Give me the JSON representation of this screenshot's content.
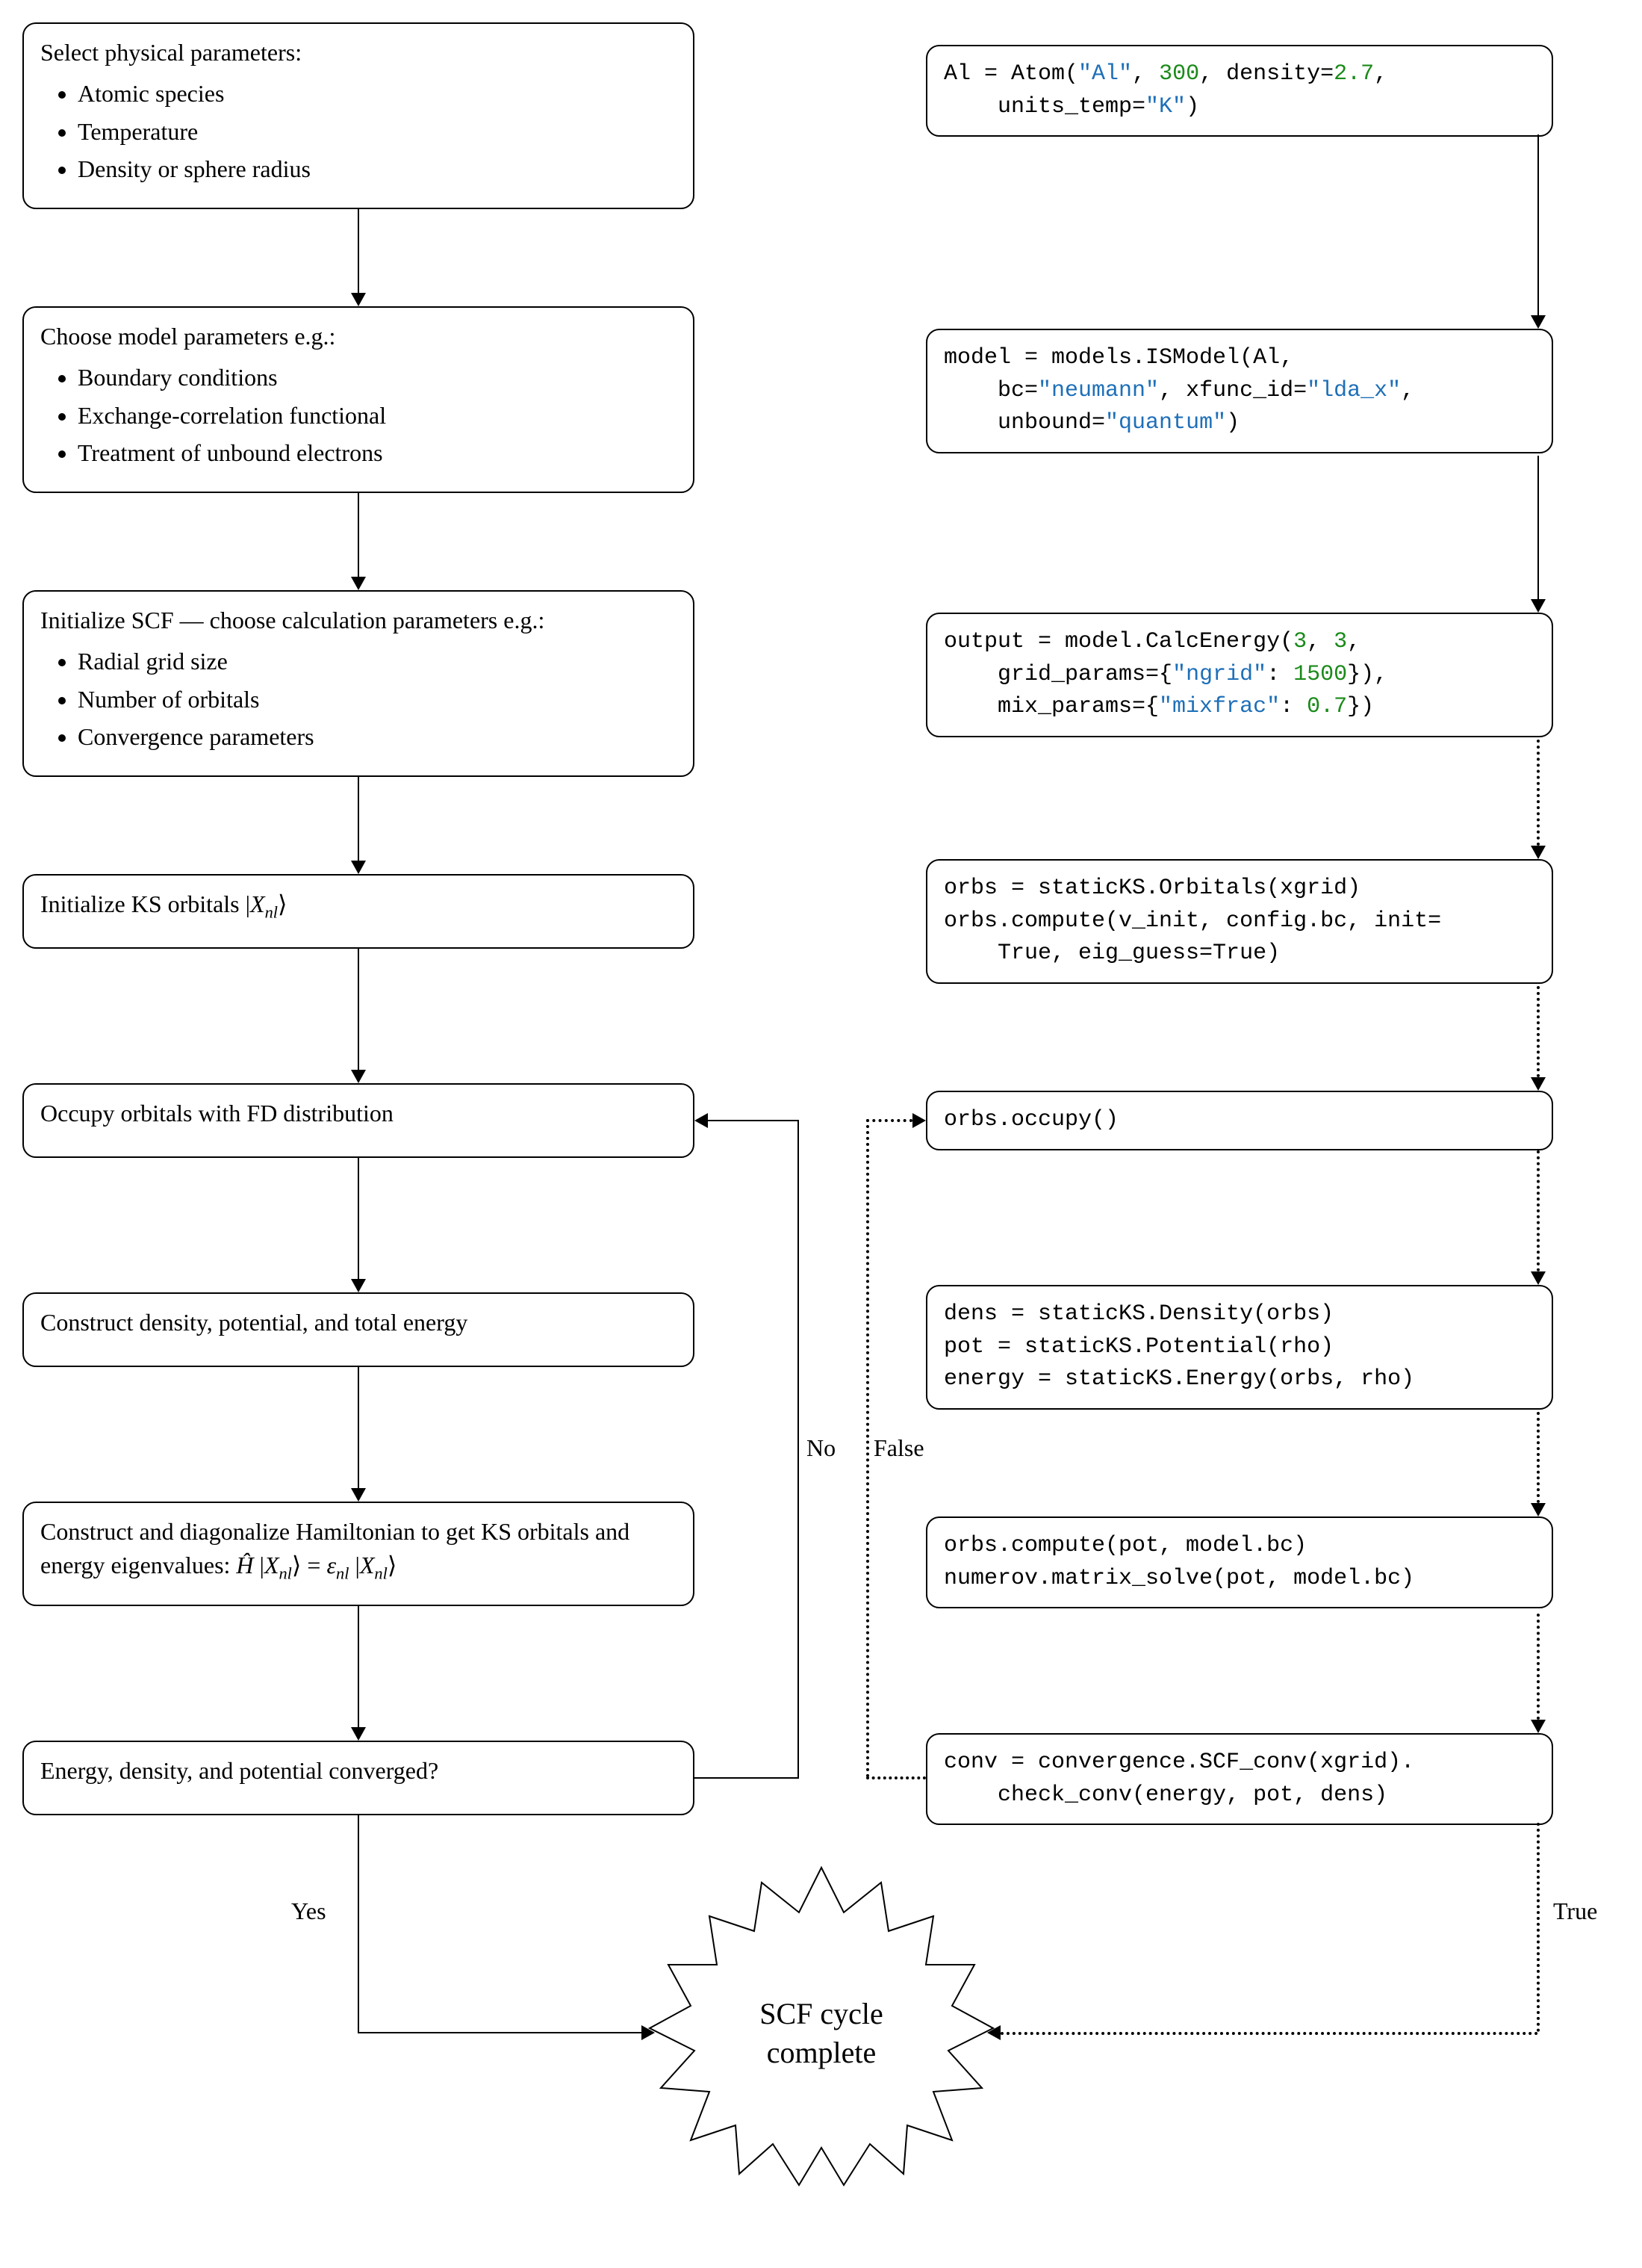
{
  "left": {
    "n1": {
      "title": "Select physical parameters:",
      "items": [
        "Atomic species",
        "Temperature",
        "Density or sphere radius"
      ]
    },
    "n2": {
      "title": "Choose model parameters e.g.:",
      "items": [
        "Boundary conditions",
        "Exchange-correlation functional",
        "Treatment of unbound electrons"
      ]
    },
    "n3": {
      "title": "Initialize SCF — choose calculation parameters e.g.:",
      "items": [
        "Radial grid size",
        "Number of orbitals",
        "Convergence parameters"
      ]
    },
    "n4": "Initialize KS orbitals |X_nl⟩",
    "n5": "Occupy orbitals with FD distribution",
    "n6": "Construct density, potential, and total energy",
    "n7": "Construct and diagonalize Hamiltonian to get KS orbitals and energy eigenvalues: Ĥ |X_nl⟩ = ε_nl |X_nl⟩",
    "n8": "Energy, density, and potential converged?"
  },
  "right": {
    "r1": {
      "l1a": "Al = Atom(",
      "l1b": "\"Al\"",
      "l1c": ", ",
      "l1d": "300",
      "l1e": ", density=",
      "l1f": "2.7",
      "l1g": ",",
      "l2a": "    units_temp=",
      "l2b": "\"K\"",
      "l2c": ")"
    },
    "r2": {
      "l1": "model = models.ISModel(Al,",
      "l2a": "    bc=",
      "l2b": "\"neumann\"",
      "l2c": ", xfunc_id=",
      "l2d": "\"lda_x\"",
      "l2e": ",",
      "l3a": "    unbound=",
      "l3b": "\"quantum\"",
      "l3c": ")"
    },
    "r3": {
      "l1a": "output = model.CalcEnergy(",
      "l1b": "3",
      "l1c": ", ",
      "l1d": "3",
      "l1e": ",",
      "l2a": "    grid_params={",
      "l2b": "\"ngrid\"",
      "l2c": ": ",
      "l2d": "1500",
      "l2e": "}),",
      "l3a": "    mix_params={",
      "l3b": "\"mixfrac\"",
      "l3c": ": ",
      "l3d": "0.7",
      "l3e": "})"
    },
    "r4": {
      "l1": "orbs = staticKS.Orbitals(xgrid)",
      "l2": "orbs.compute(v_init, config.bc, init=",
      "l3": "    True, eig_guess=True)"
    },
    "r5": "orbs.occupy()",
    "r6": {
      "l1": "dens = staticKS.Density(orbs)",
      "l2": "pot = staticKS.Potential(rho)",
      "l3": "energy = staticKS.Energy(orbs, rho)"
    },
    "r7": {
      "l1": "orbs.compute(pot, model.bc)",
      "l2": "numerov.matrix_solve(pot, model.bc)"
    },
    "r8": {
      "l1": "conv = convergence.SCF_conv(xgrid).",
      "l2": "    check_conv(energy, pot, dens)"
    }
  },
  "labels": {
    "no": "No",
    "yes": "Yes",
    "false": "False",
    "true": "True"
  },
  "final": "SCF cycle complete"
}
